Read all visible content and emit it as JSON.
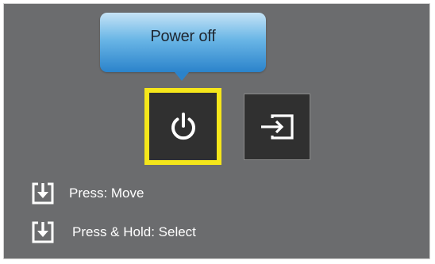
{
  "tooltip": {
    "label": "Power off"
  },
  "menu": {
    "items": [
      {
        "id": "power",
        "icon": "power-icon",
        "selected": true
      },
      {
        "id": "source",
        "icon": "source-input-icon",
        "selected": false
      }
    ]
  },
  "hints": {
    "move_label": "Press: Move",
    "select_label": "Press & Hold: Select",
    "icon": "joystick-press-icon"
  },
  "colors": {
    "background": "#6b6c6e",
    "selection_border": "#f5e61a",
    "tile": "#303030",
    "tooltip_gradient_top": "#c5e3f6",
    "tooltip_gradient_bottom": "#2b83cb",
    "hint_text": "#ffffff"
  }
}
